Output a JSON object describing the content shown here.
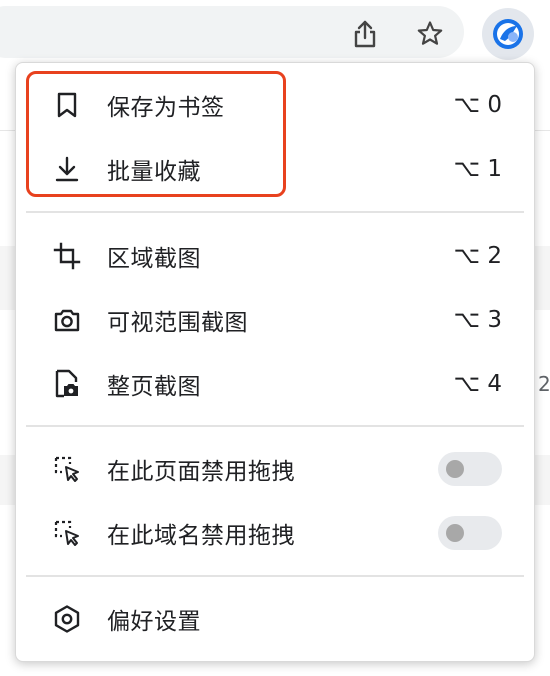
{
  "toolbar": {
    "share_icon": "share-icon",
    "star_icon": "bookmark-star-icon",
    "extension_icon": "extension-logo-icon"
  },
  "background": {
    "peek_text": "2"
  },
  "menu": {
    "items": [
      {
        "label": "保存为书签",
        "shortcut": "⌥ 0",
        "icon": "bookmark-icon"
      },
      {
        "label": "批量收藏",
        "shortcut": "⌥ 1",
        "icon": "download-icon"
      },
      {
        "label": "区域截图",
        "shortcut": "⌥ 2",
        "icon": "crop-icon"
      },
      {
        "label": "可视范围截图",
        "shortcut": "⌥ 3",
        "icon": "camera-icon"
      },
      {
        "label": "整页截图",
        "shortcut": "⌥ 4",
        "icon": "fullpage-screenshot-icon"
      },
      {
        "label": "在此页面禁用拖拽",
        "icon": "drag-select-icon",
        "toggle_on": false
      },
      {
        "label": "在此域名禁用拖拽",
        "icon": "drag-select-icon",
        "toggle_on": false
      },
      {
        "label": "偏好设置",
        "icon": "settings-hexagon-icon"
      }
    ]
  },
  "colors": {
    "highlight_border": "#e8411e",
    "extension_blue": "#1a73e8",
    "toggle_track": "#e8eaed",
    "toggle_knob": "#a8a8a8"
  }
}
